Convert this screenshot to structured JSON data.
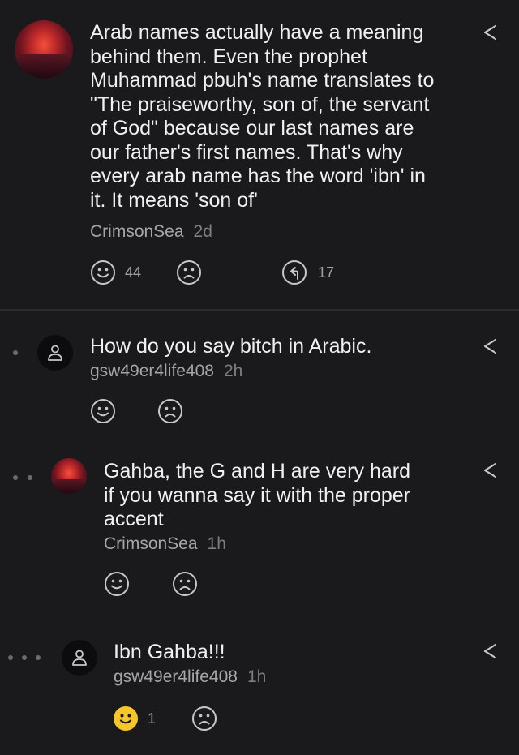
{
  "comments": [
    {
      "text": "Arab names actually have a meaning\nbehind them. Even the prophet\nMuhammad pbuh's name translates to\n\"The praiseworthy, son of, the servant\nof God\" because our last names are\nour father's first names. That's why\nevery arab name has the word 'ibn' in\nit. It means 'son of'",
      "author": "CrimsonSea",
      "age": "2d",
      "likes": "44",
      "replies": "17",
      "avatar": "sunset-photo"
    },
    {
      "text": "How do you say bitch in Arabic.",
      "author": "gsw49er4life408",
      "age": "2h",
      "avatar": "user-icon"
    },
    {
      "text": "Gahba, the G and H are very hard\nif you wanna say it with the proper\naccent",
      "author": "CrimsonSea",
      "age": "1h",
      "avatar": "sunset-photo"
    },
    {
      "text": "Ibn Gahba!!!",
      "author": "gsw49er4life408",
      "age": "1h",
      "likes": "1",
      "liked": true,
      "avatar": "user-icon"
    }
  ],
  "colors": {
    "background": "#1a1a1c",
    "text": "#f0f0f0",
    "meta": "#a6a6a8",
    "icon": "#c8c8ca",
    "liked": "#f4c62a"
  }
}
